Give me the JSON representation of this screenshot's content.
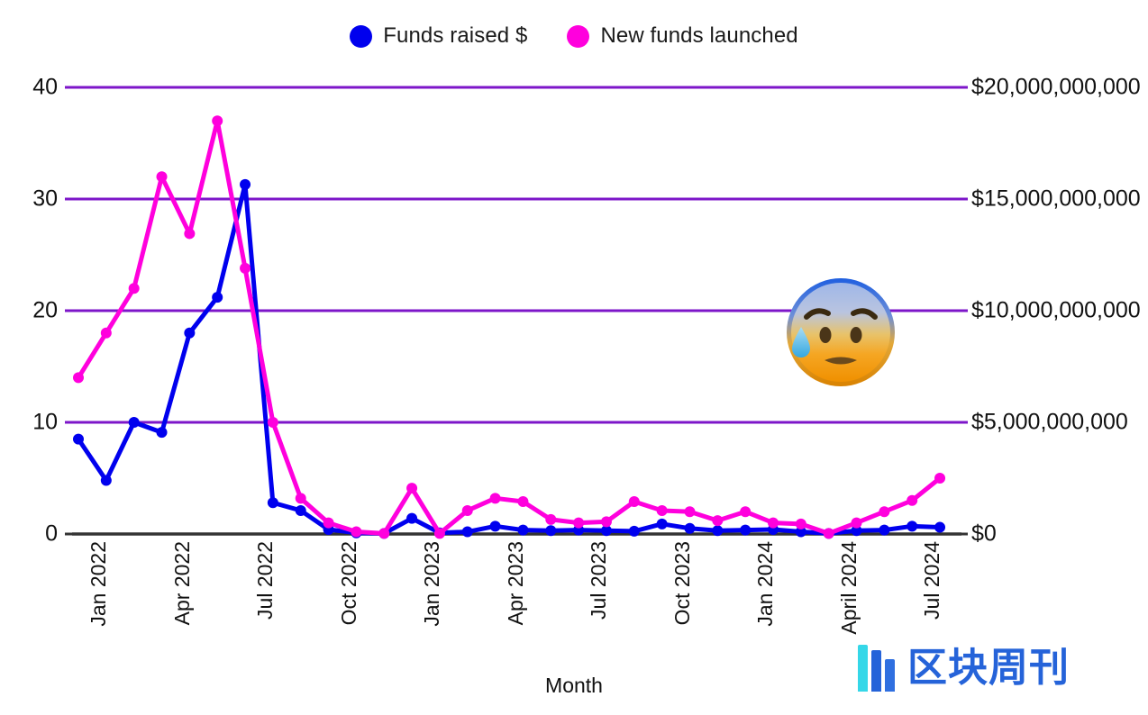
{
  "legend": {
    "items": [
      {
        "label": "Funds raised $",
        "color": "#0000ee",
        "icon": "circle-marker-icon"
      },
      {
        "label": "New funds launched",
        "color": "#ff00dd",
        "icon": "circle-marker-icon"
      }
    ]
  },
  "axes": {
    "x_title": "Month",
    "y_left_ticks": [
      "0",
      "10",
      "20",
      "30",
      "40"
    ],
    "y_right_ticks": [
      "$0",
      "$5,000,000,000",
      "$10,000,000,000",
      "$15,000,000,000",
      "$20,000,000,000"
    ],
    "x_tick_labels": [
      "Jan 2022",
      "Apr 2022",
      "Jul 2022",
      "Oct 2022",
      "Jan 2023",
      "Apr 2023",
      "Jul 2023",
      "Oct 2023",
      "Jan 2024",
      "April 2024",
      "Jul 2024"
    ],
    "gridline_color": "#7d16c9",
    "axis_line_color": "#333333"
  },
  "annotations": {
    "emoji": "anxious-face-with-sweat",
    "emoji_char": "😰"
  },
  "watermark": {
    "text": "区块周刊",
    "bar_colors": [
      "#35d7e8",
      "#2563d9",
      "#2f6fe0"
    ],
    "text_color": "#2563d9"
  },
  "chart_data": {
    "type": "line",
    "title": "",
    "xlabel": "Month",
    "ylabel_left": "",
    "ylabel_right": "",
    "ylim_left": [
      0,
      40
    ],
    "ylim_right": [
      0,
      20000000000
    ],
    "grid": true,
    "legend_position": "top-center",
    "x": [
      "Jan 2022",
      "Feb 2022",
      "Mar 2022",
      "Apr 2022",
      "May 2022",
      "Jun 2022",
      "Jul 2022",
      "Aug 2022",
      "Sep 2022",
      "Oct 2022",
      "Nov 2022",
      "Dec 2022",
      "Jan 2023",
      "Feb 2023",
      "Mar 2023",
      "Apr 2023",
      "May 2023",
      "Jun 2023",
      "Jul 2023",
      "Aug 2023",
      "Sep 2023",
      "Oct 2023",
      "Nov 2023",
      "Dec 2023",
      "Jan 2024",
      "Feb 2024",
      "Mar 2024",
      "April 2024",
      "May 2024",
      "Jun 2024",
      "Jul 2024",
      "Aug 2024"
    ],
    "series": [
      {
        "name": "Funds raised $",
        "color": "#0000ee",
        "axis": "right",
        "unit": "USD",
        "values_axis_units": [
          8.5,
          4.8,
          10.0,
          9.1,
          18.0,
          21.2,
          31.3,
          2.8,
          2.1,
          0.4,
          0.1,
          0.05,
          1.4,
          0.1,
          0.2,
          0.7,
          0.35,
          0.3,
          0.35,
          0.3,
          0.25,
          0.9,
          0.5,
          0.3,
          0.35,
          0.4,
          0.2,
          0.05,
          0.3,
          0.35,
          0.7,
          0.6
        ],
        "values_usd": [
          4250000000,
          2400000000,
          5000000000,
          4550000000,
          9000000000,
          10600000000,
          15650000000,
          1400000000,
          1050000000,
          200000000,
          50000000,
          25000000,
          700000000,
          50000000,
          100000000,
          350000000,
          175000000,
          150000000,
          175000000,
          150000000,
          125000000,
          450000000,
          250000000,
          150000000,
          175000000,
          200000000,
          100000000,
          25000000,
          150000000,
          175000000,
          350000000,
          300000000
        ]
      },
      {
        "name": "New funds launched",
        "color": "#ff00dd",
        "axis": "left",
        "unit": "count",
        "values": [
          14.0,
          18.0,
          22.0,
          32.0,
          26.9,
          37.0,
          23.8,
          10.0,
          3.2,
          1.0,
          0.2,
          0.05,
          4.1,
          0.05,
          2.1,
          3.2,
          2.9,
          1.3,
          1.0,
          1.1,
          2.9,
          2.1,
          2.0,
          1.2,
          2.0,
          1.0,
          0.9,
          0.05,
          1.0,
          2.0,
          3.0,
          5.0
        ]
      }
    ]
  }
}
